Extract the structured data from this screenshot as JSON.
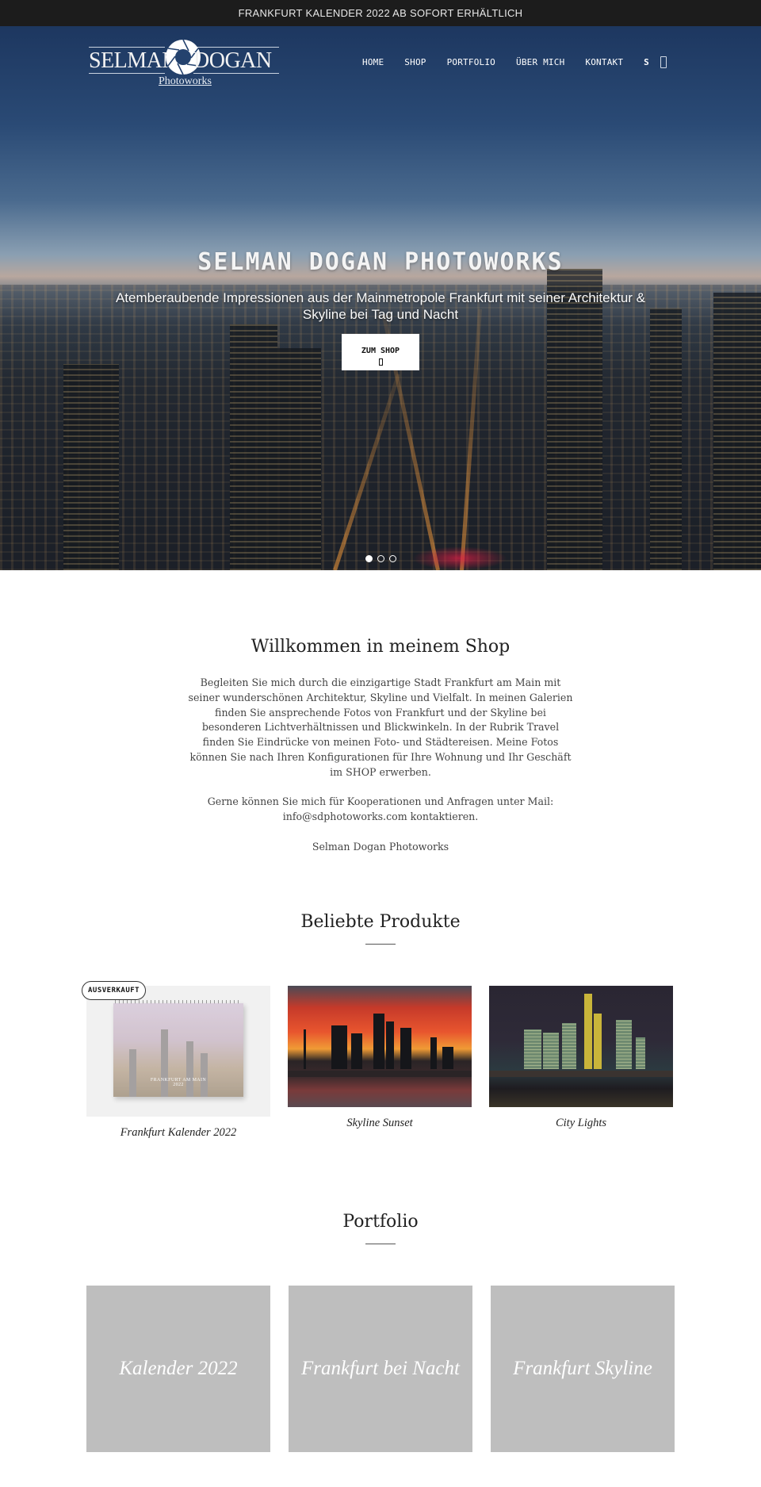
{
  "announcement": "FRANKFURT KALENDER 2022 AB SOFORT ERHÄLTLICH",
  "logo": {
    "left_word": "SELMAN",
    "right_word": "DOGAN",
    "subtitle": "Photoworks"
  },
  "nav": {
    "items": [
      {
        "label": "HOME"
      },
      {
        "label": "SHOP"
      },
      {
        "label": "PORTFOLIO"
      },
      {
        "label": "ÜBER MICH"
      },
      {
        "label": "KONTAKT"
      }
    ],
    "search_label": "S",
    "cart_icon": "cart-icon"
  },
  "hero": {
    "title": "SELMAN DOGAN PHOTOWORKS",
    "subtitle": "Atemberaubende Impressionen aus der Mainmetropole Frankfurt mit seiner Architektur & Skyline bei Tag und Nacht",
    "button_label": "ZUM SHOP",
    "button_icon": "arrow-icon",
    "slides": 3,
    "active_slide": 1
  },
  "welcome": {
    "title": "Willkommen in meinem Shop",
    "paragraphs": [
      "Begleiten Sie mich durch die einzigartige Stadt Frankfurt am Main mit seiner wunderschönen Architektur, Skyline und Vielfalt. In meinen Galerien finden Sie ansprechende Fotos von Frankfurt und der Skyline bei besonderen Lichtverhältnissen und Blickwinkeln. In der Rubrik Travel finden Sie Eindrücke von meinen Foto- und Städtereisen. Meine Fotos können Sie nach Ihren Konfigurationen für Ihre Wohnung und Ihr Geschäft im SHOP erwerben.",
      "Gerne können Sie mich für Kooperationen und Anfragen unter Mail: info@sdphotoworks.com kontaktieren.",
      "Selman Dogan Photoworks"
    ]
  },
  "products": {
    "title": "Beliebte Produkte",
    "items": [
      {
        "name": "Frankfurt Kalender 2022",
        "badge": "AUSVERKAUFT",
        "image_caption": "FRANKFURT AM MAIN",
        "image_year": "2022"
      },
      {
        "name": "Skyline Sunset"
      },
      {
        "name": "City Lights"
      }
    ]
  },
  "portfolio": {
    "title": "Portfolio",
    "items": [
      {
        "label": "Kalender 2022"
      },
      {
        "label": "Frankfurt bei Nacht"
      },
      {
        "label": "Frankfurt Skyline"
      }
    ]
  },
  "colors": {
    "announcement_bg": "#1c1c1c",
    "portfolio_tile": "#bebebe",
    "text_dark": "#222222"
  }
}
